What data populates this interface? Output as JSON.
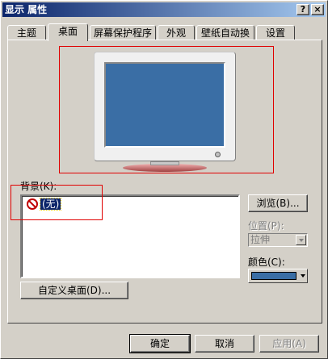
{
  "window": {
    "title": "显示 属性",
    "help_label": "?",
    "close_label": "×"
  },
  "tabs": [
    {
      "label": "主题",
      "active": false
    },
    {
      "label": "桌面",
      "active": true
    },
    {
      "label": "屏幕保护程序",
      "active": false
    },
    {
      "label": "外观",
      "active": false
    },
    {
      "label": "壁纸自动换",
      "active": false
    },
    {
      "label": "设置",
      "active": false
    }
  ],
  "preview": {
    "screen_color": "#3a6ea5",
    "icon": "monitor-icon"
  },
  "background": {
    "label": "背景(K):",
    "items": [
      {
        "label": "(无)",
        "icon": "none-icon",
        "selected": true
      }
    ]
  },
  "browse_button": "浏览(B)...",
  "position": {
    "label": "位置(P):",
    "value": "拉伸"
  },
  "color": {
    "label": "颜色(C):",
    "value": "#3a6ea5"
  },
  "customize_button": "自定义桌面(D)...",
  "footer": {
    "ok": "确定",
    "cancel": "取消",
    "apply": "应用(A)"
  }
}
